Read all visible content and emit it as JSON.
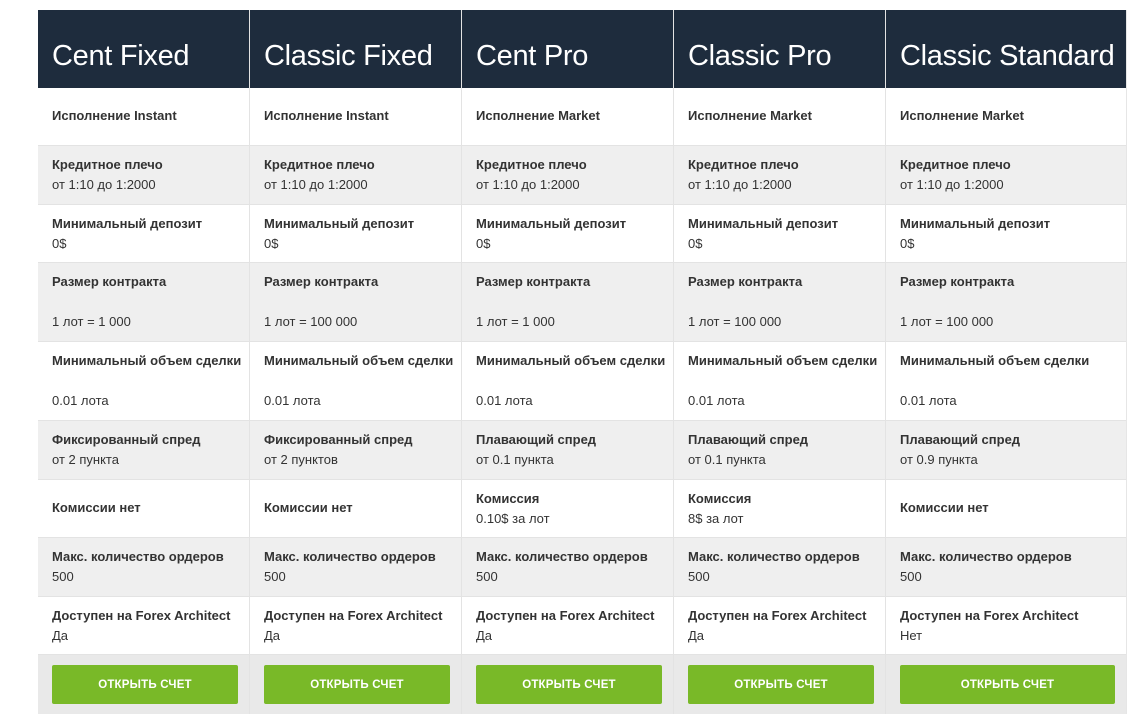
{
  "plans": [
    {
      "name": "Cent Fixed",
      "execution": "Исполнение Instant",
      "leverage": {
        "label": "Кредитное плечо",
        "value": "от 1:10 до 1:2000"
      },
      "min_deposit": {
        "label": "Минимальный депозит",
        "value": "0$"
      },
      "contract_size": {
        "label": "Размер контракта",
        "value": "1 лот = 1 000"
      },
      "min_volume": {
        "label": "Минимальный объем сделки",
        "value": "0.01 лота"
      },
      "spread": {
        "label": "Фиксированный спред",
        "value": "от 2 пункта"
      },
      "commission": {
        "label": "Комиссии нет",
        "value": ""
      },
      "max_orders": {
        "label": "Макс. количество ордеров",
        "value": "500"
      },
      "forex_architect": {
        "label": "Доступен на Forex Architect",
        "value": "Да"
      },
      "button_label": "ОТКРЫТЬ СЧЕТ"
    },
    {
      "name": "Classic Fixed",
      "execution": "Исполнение Instant",
      "leverage": {
        "label": "Кредитное плечо",
        "value": "от 1:10 до 1:2000"
      },
      "min_deposit": {
        "label": "Минимальный депозит",
        "value": "0$"
      },
      "contract_size": {
        "label": "Размер контракта",
        "value": "1 лот = 100 000"
      },
      "min_volume": {
        "label": "Минимальный объем сделки",
        "value": "0.01 лота"
      },
      "spread": {
        "label": "Фиксированный спред",
        "value": "от 2 пунктов"
      },
      "commission": {
        "label": "Комиссии нет",
        "value": ""
      },
      "max_orders": {
        "label": "Макс. количество ордеров",
        "value": "500"
      },
      "forex_architect": {
        "label": "Доступен на Forex Architect",
        "value": "Да"
      },
      "button_label": "ОТКРЫТЬ СЧЕТ"
    },
    {
      "name": "Cent Pro",
      "execution": "Исполнение Market",
      "leverage": {
        "label": "Кредитное плечо",
        "value": "от 1:10 до 1:2000"
      },
      "min_deposit": {
        "label": "Минимальный депозит",
        "value": "0$"
      },
      "contract_size": {
        "label": "Размер контракта",
        "value": "1 лот = 1 000"
      },
      "min_volume": {
        "label": "Минимальный объем сделки",
        "value": "0.01 лота"
      },
      "spread": {
        "label": "Плавающий спред",
        "value": "от 0.1 пункта"
      },
      "commission": {
        "label": "Комиссия",
        "value": "0.10$ за лот"
      },
      "max_orders": {
        "label": "Макс. количество ордеров",
        "value": "500"
      },
      "forex_architect": {
        "label": "Доступен на Forex Architect",
        "value": "Да"
      },
      "button_label": "ОТКРЫТЬ СЧЕТ"
    },
    {
      "name": "Classic Pro",
      "execution": "Исполнение Market",
      "leverage": {
        "label": "Кредитное плечо",
        "value": "от 1:10 до 1:2000"
      },
      "min_deposit": {
        "label": "Минимальный депозит",
        "value": "0$"
      },
      "contract_size": {
        "label": "Размер контракта",
        "value": "1 лот = 100 000"
      },
      "min_volume": {
        "label": "Минимальный объем сделки",
        "value": "0.01 лота"
      },
      "spread": {
        "label": "Плавающий спред",
        "value": "от 0.1 пункта"
      },
      "commission": {
        "label": "Комиссия",
        "value": "8$ за лот"
      },
      "max_orders": {
        "label": "Макс. количество ордеров",
        "value": "500"
      },
      "forex_architect": {
        "label": "Доступен на Forex Architect",
        "value": "Да"
      },
      "button_label": "ОТКРЫТЬ СЧЕТ"
    },
    {
      "name": "Classic Standard",
      "execution": "Исполнение Market",
      "leverage": {
        "label": "Кредитное плечо",
        "value": "от 1:10 до 1:2000"
      },
      "min_deposit": {
        "label": "Минимальный депозит",
        "value": "0$"
      },
      "contract_size": {
        "label": "Размер контракта",
        "value": "1 лот = 100 000"
      },
      "min_volume": {
        "label": "Минимальный объем сделки",
        "value": "0.01 лота"
      },
      "spread": {
        "label": "Плавающий спред",
        "value": "от 0.9 пункта"
      },
      "commission": {
        "label": "Комиссии нет",
        "value": ""
      },
      "max_orders": {
        "label": "Макс. количество ордеров",
        "value": "500"
      },
      "forex_architect": {
        "label": "Доступен на Forex Architect",
        "value": "Нет"
      },
      "button_label": "ОТКРЫТЬ СЧЕТ"
    }
  ],
  "colors": {
    "header_bg": "#1e2c3d",
    "button_bg": "#79b928",
    "alt_row_bg": "#efefef"
  }
}
